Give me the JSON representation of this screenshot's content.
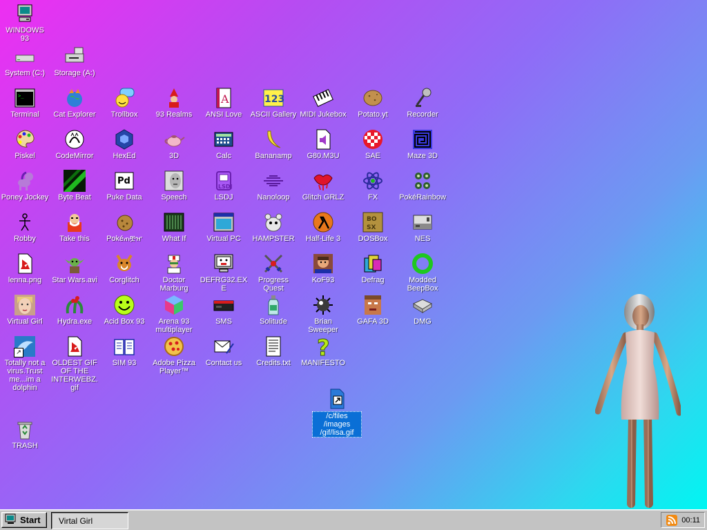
{
  "desktop": {
    "icons": [
      {
        "id": "windows93",
        "label": "WINDOWS 93",
        "icon": "computer-icon"
      },
      {
        "id": "system-c",
        "label": "System (C:)",
        "icon": "hard-drive-icon"
      },
      {
        "id": "storage-a",
        "label": "Storage (A:)",
        "icon": "floppy-drive-icon"
      },
      {
        "id": "terminal",
        "label": "Terminal",
        "icon": "terminal-icon"
      },
      {
        "id": "cat-explorer",
        "label": "Cat Explorer",
        "icon": "cat-globe-icon"
      },
      {
        "id": "trollbox",
        "label": "Trollbox",
        "icon": "troll-chat-icon"
      },
      {
        "id": "93-realms",
        "label": "93 Realms",
        "icon": "wizard-icon"
      },
      {
        "id": "ansi-love",
        "label": "ANSI Love",
        "icon": "ansi-letter-icon"
      },
      {
        "id": "ascii-gallery",
        "label": "ASCII Gallery",
        "icon": "ascii-123-icon"
      },
      {
        "id": "midi-jukebox",
        "label": "MIDI Jukebox",
        "icon": "piano-icon"
      },
      {
        "id": "potato-yt",
        "label": "Potato.yt",
        "icon": "potato-icon"
      },
      {
        "id": "recorder",
        "label": "Recorder",
        "icon": "microphone-icon"
      },
      {
        "id": "piskel",
        "label": "Piskel",
        "icon": "palette-icon"
      },
      {
        "id": "codemirror",
        "label": "CodeMirror",
        "icon": "mirror-cat-icon"
      },
      {
        "id": "hexed",
        "label": "HexEd",
        "icon": "hex-cube-icon"
      },
      {
        "id": "3d",
        "label": "3D",
        "icon": "teapot-icon"
      },
      {
        "id": "calc",
        "label": "Calc",
        "icon": "calculator-icon"
      },
      {
        "id": "bananamp",
        "label": "Bananamp",
        "icon": "banana-icon"
      },
      {
        "id": "g80-m3u",
        "label": "G80.M3U",
        "icon": "audio-file-icon"
      },
      {
        "id": "sae",
        "label": "SAE",
        "icon": "checker-ball-icon"
      },
      {
        "id": "maze-3d",
        "label": "Maze 3D",
        "icon": "maze-icon"
      },
      {
        "id": "poney-jockey",
        "label": "Poney Jockey",
        "icon": "pony-icon"
      },
      {
        "id": "byte-beat",
        "label": "Byte Beat",
        "icon": "bytebeat-icon"
      },
      {
        "id": "puke-data",
        "label": "Puke Data",
        "icon": "pd-icon"
      },
      {
        "id": "speech",
        "label": "Speech",
        "icon": "face-speech-icon"
      },
      {
        "id": "lsdj",
        "label": "LSDJ",
        "icon": "lsdj-icon"
      },
      {
        "id": "nanoloop",
        "label": "Nanoloop",
        "icon": "waveform-icon"
      },
      {
        "id": "glitch-grlz",
        "label": "Glitch GRLZ",
        "icon": "lips-icon"
      },
      {
        "id": "fx",
        "label": "FX",
        "icon": "atom-icon"
      },
      {
        "id": "pokerainbow",
        "label": "PokéRainbow",
        "icon": "pokerainbow-icon"
      },
      {
        "id": "robby",
        "label": "Robby",
        "icon": "stick-figure-icon"
      },
      {
        "id": "take-this",
        "label": "Take this",
        "icon": "old-man-icon"
      },
      {
        "id": "pokemon",
        "label": "Pokéጠቿዠ",
        "icon": "cookie-creature-icon"
      },
      {
        "id": "what-if",
        "label": "What If",
        "icon": "grid-window-icon"
      },
      {
        "id": "virtual-pc",
        "label": "Virtual PC",
        "icon": "window-app-icon"
      },
      {
        "id": "hampster",
        "label": "HAMPSTER",
        "icon": "hamster-icon"
      },
      {
        "id": "half-life-3",
        "label": "Half-Life 3",
        "icon": "lambda-icon"
      },
      {
        "id": "dosbox",
        "label": "DOSBox",
        "icon": "dosbox-icon"
      },
      {
        "id": "nes",
        "label": "NES",
        "icon": "nes-console-icon"
      },
      {
        "id": "lenna",
        "label": "lenna.png",
        "icon": "image-file-icon"
      },
      {
        "id": "star-wars",
        "label": "Star Wars.avi",
        "icon": "yoda-icon"
      },
      {
        "id": "corglitch",
        "label": "Corglitch",
        "icon": "corgi-icon"
      },
      {
        "id": "doctor-marburg",
        "label": "Doctor Marburg",
        "icon": "doctor-icon"
      },
      {
        "id": "defrg32",
        "label": "DEFRG32.EXE",
        "icon": "monitor-face-icon"
      },
      {
        "id": "progress-quest",
        "label": "Progress Quest",
        "icon": "crossed-swords-icon"
      },
      {
        "id": "kof93",
        "label": "KoF93",
        "icon": "fighter-icon"
      },
      {
        "id": "defrag",
        "label": "Defrag",
        "icon": "defrag-icon"
      },
      {
        "id": "modded-beepbox",
        "label": "Modded BeepBox",
        "icon": "ring-icon"
      },
      {
        "id": "virtual-girl",
        "label": "Virtual Girl",
        "icon": "girl-face-icon"
      },
      {
        "id": "hydra",
        "label": "Hydra.exe",
        "icon": "hydra-icon"
      },
      {
        "id": "acid-box-93",
        "label": "Acid Box 93",
        "icon": "smiley-icon"
      },
      {
        "id": "arena-93",
        "label": "Arena 93 multiplayer",
        "icon": "cube-icon"
      },
      {
        "id": "sms",
        "label": "SMS",
        "icon": "sms-console-icon"
      },
      {
        "id": "solitude",
        "label": "Solitude",
        "icon": "bottle-icon"
      },
      {
        "id": "brian-sweeper",
        "label": "Brian Sweeper",
        "icon": "mine-icon"
      },
      {
        "id": "gafa-3d",
        "label": "GAFA 3D",
        "icon": "doom-face-icon"
      },
      {
        "id": "dmg",
        "label": "DMG",
        "icon": "dmg-console-icon"
      },
      {
        "id": "dolphin",
        "label": "Totally not a virus.Trust me...im a dolphin",
        "icon": "dolphin-icon"
      },
      {
        "id": "oldest-gif",
        "label": "OLDEST GIF OF THE INTERWEBZ.gif",
        "icon": "image-file-icon"
      },
      {
        "id": "sim-93",
        "label": "SIM 93",
        "icon": "book-icon"
      },
      {
        "id": "adobe-pizza",
        "label": "Adobe Pizza Player™",
        "icon": "pizza-icon"
      },
      {
        "id": "contact-us",
        "label": "Contact us",
        "icon": "envelope-icon"
      },
      {
        "id": "credits",
        "label": "Credits.txt",
        "icon": "text-file-icon"
      },
      {
        "id": "manifesto",
        "label": "MANIFESTO",
        "icon": "question-icon"
      },
      {
        "id": "trash",
        "label": "TRASH",
        "icon": "recycle-bin-icon"
      },
      {
        "id": "lisa-gif",
        "label": "/c/files /images /gif/lisa.gif",
        "icon": "shortcut-file-icon",
        "selected": true
      }
    ]
  },
  "taskbar": {
    "start_label": "Start",
    "active_task": "Virtal Girl",
    "clock": "00:11"
  },
  "colors": {
    "gradient_start": "#ee2ef2",
    "gradient_end": "#00f6f2",
    "taskbar": "#c3c3c3",
    "selection": "#0a6fd6"
  }
}
